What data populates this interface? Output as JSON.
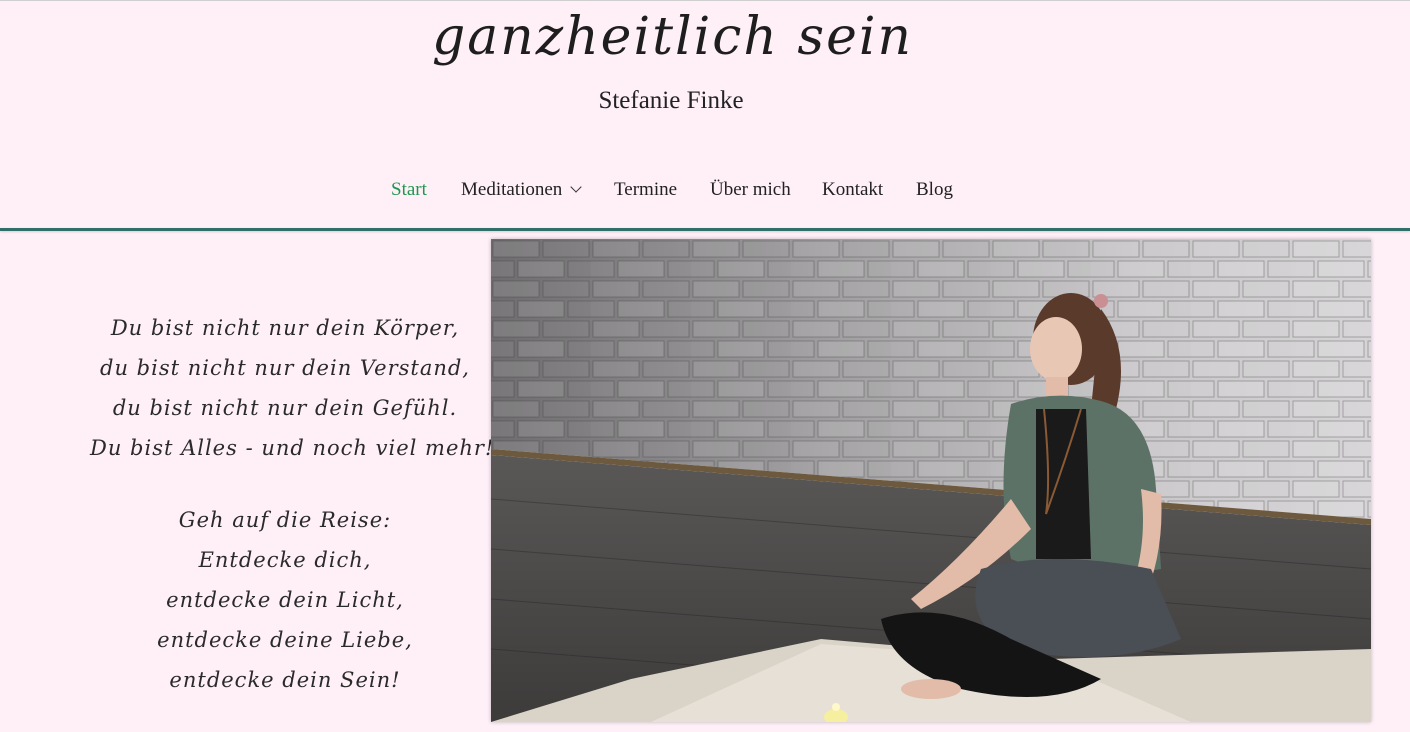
{
  "site": {
    "title": "ganzheitlich sein",
    "subtitle": "Stefanie Finke"
  },
  "nav": {
    "items": [
      {
        "label": "Start",
        "active": true
      },
      {
        "label": "Meditationen",
        "dropdown": true
      },
      {
        "label": "Termine"
      },
      {
        "label": "Über mich"
      },
      {
        "label": "Kontakt"
      },
      {
        "label": "Blog"
      }
    ]
  },
  "poem": {
    "stanza1": [
      "Du bist nicht nur dein Körper,",
      "du bist nicht nur dein Verstand,",
      "du bist nicht nur dein Gefühl.",
      "Du bist Alles - und noch viel mehr!"
    ],
    "stanza2": [
      "Geh auf die Reise:",
      "Entdecke dich,",
      "entdecke dein Licht,",
      "entdecke deine Liebe,",
      "entdecke dein Sein!"
    ]
  },
  "colors": {
    "background": "#fff0f8",
    "accent_active": "#1f9650",
    "header_border": "#2f6f68"
  },
  "hero_image": {
    "icon": "meditation-photo"
  }
}
